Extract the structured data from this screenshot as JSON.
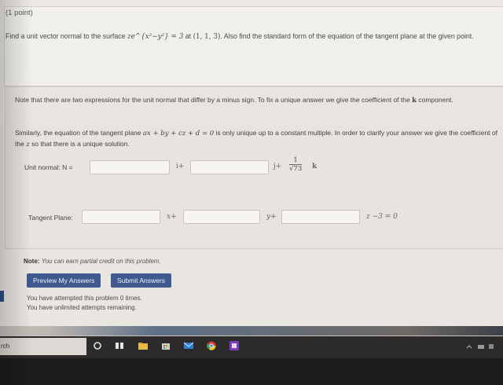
{
  "problem": {
    "points": "(1 point)",
    "question_pre": "Find a unit vector normal to the surface ",
    "surface_expr": "ze^{x²−y²} = 3",
    "question_mid": " at ",
    "point": "(1, 1, 3)",
    "question_post": ". Also find the standard form of the equation of the tangent plane at the given point."
  },
  "hint": {
    "note1_pre": "Note that there are two expressions for the unit normal that differ by a minus sign. To fix a unique answer we give the coefficient of the ",
    "k": "k",
    "note1_post": " component.",
    "note2_pre": "Similarly, the equation of the tangent plane ",
    "plane_expr": "ax + by + cz + d = 0",
    "note2_mid": " is only unique up to a constant multiple. In order to clarify your answer we give the coefficient of the ",
    "z": "z",
    "note2_post": " so that there is a unique solution."
  },
  "unit_normal": {
    "label": "Unit normal: N =",
    "i": "i+",
    "j": "j+",
    "frac_num": "1",
    "frac_den": "√73",
    "k": "k",
    "input1": "",
    "input2": ""
  },
  "tangent_plane": {
    "label": "Tangent Plane:",
    "x": "x+",
    "y": "y+",
    "tail": "z −3 = 0",
    "input1": "",
    "input2": "",
    "input3": ""
  },
  "note_credit": {
    "bold": "Note:",
    "text": "You can earn partial credit on this problem."
  },
  "buttons": {
    "preview": "Preview My Answers",
    "submit": "Submit Answers"
  },
  "attempts": {
    "line1": "You have attempted this problem 0 times.",
    "line2": "You have unlimited attempts remaining."
  },
  "taskbar": {
    "search_text": "rch"
  }
}
